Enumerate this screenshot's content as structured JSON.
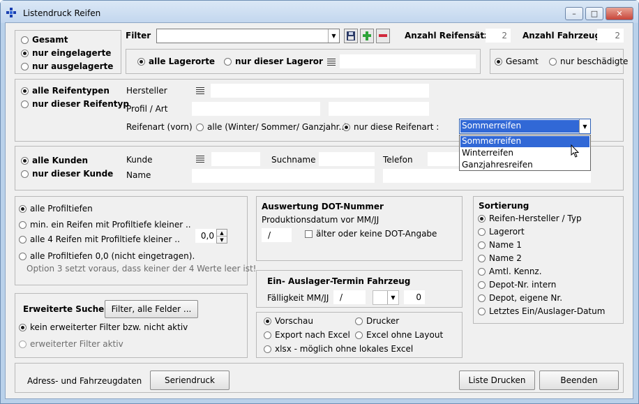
{
  "window": {
    "title": "Listendruck Reifen"
  },
  "scope": {
    "options": [
      "Gesamt",
      "nur eingelagerte",
      "nur ausgelagerte"
    ],
    "selected": 1
  },
  "filter": {
    "label": "Filter",
    "value": ""
  },
  "stats": {
    "reifen_label": "Anzahl Reifensätze",
    "reifen_value": "2",
    "fahrzeuge_label": "Anzahl Fahrzeuge",
    "fahrzeuge_value": "2"
  },
  "lager": {
    "option_all": "alle Lagerorte",
    "option_one": "nur dieser Lageror",
    "value": ""
  },
  "damage": {
    "option_all": "Gesamt",
    "option_damaged": "nur beschädigte"
  },
  "reifentyp": {
    "option_all": "alle Reifentypen",
    "option_one": "nur dieser Reifentyp",
    "hersteller_label": "Hersteller",
    "profil_label": "Profil / Art",
    "reifenart_label": "Reifenart (vorn)",
    "reifenart_all": "alle (Winter/ Sommer/ Ganzjahr..)",
    "reifenart_one": "nur diese Reifenart :",
    "reifenart_selected": "Sommerreifen",
    "reifenart_options": [
      "Sommerreifen",
      "Winterreifen",
      "Ganzjahresreifen"
    ]
  },
  "kunden": {
    "option_all": "alle Kunden",
    "option_one": "nur dieser Kunde",
    "kunde_label": "Kunde",
    "suchname_label": "Suchname",
    "telefon_label": "Telefon",
    "name_label": "Name"
  },
  "profil": {
    "options": [
      "alle Profiltiefen",
      "min. ein Reifen mit Profiltiefe kleiner ..",
      "alle 4 Reifen mit Profiltiefe kleiner ..",
      "alle Profiltiefen 0,0 (nicht eingetragen)."
    ],
    "note": "Option 3 setzt voraus, dass keiner der 4 Werte leer ist!",
    "value": "0,0"
  },
  "dot": {
    "title": "Auswertung DOT-Nummer",
    "subtitle": "Produktionsdatum vor MM/JJ",
    "date_value": "/",
    "checkbox_label": "älter oder keine DOT-Angabe"
  },
  "termin": {
    "title": "Ein- Auslager-Termin Fahrzeug",
    "label": "Fälligkeit MM/JJ",
    "date_value": "/",
    "count_value": "0"
  },
  "sortierung": {
    "title": "Sortierung",
    "options": [
      "Reifen-Hersteller / Typ",
      "Lagerort",
      "Name 1",
      "Name 2",
      "Amtl. Kennz.",
      "Depot-Nr. intern",
      "Depot, eigene Nr.",
      "Letztes Ein/Auslager-Datum"
    ]
  },
  "erweitert": {
    "title": "Erweiterte Suche",
    "button": "Filter, alle Felder ...",
    "option_off": "kein erweiterter Filter bzw. nicht aktiv",
    "option_on": "erweiterter Filter aktiv"
  },
  "ausgabe": {
    "options": [
      "Vorschau",
      "Drucker",
      "Export nach Excel",
      "Excel ohne Layout",
      "xlsx - möglich ohne lokales Excel"
    ]
  },
  "footer": {
    "label": "Adress- und Fahrzeugdaten",
    "serien": "Seriendruck",
    "drucken": "Liste Drucken",
    "beenden": "Beenden"
  }
}
